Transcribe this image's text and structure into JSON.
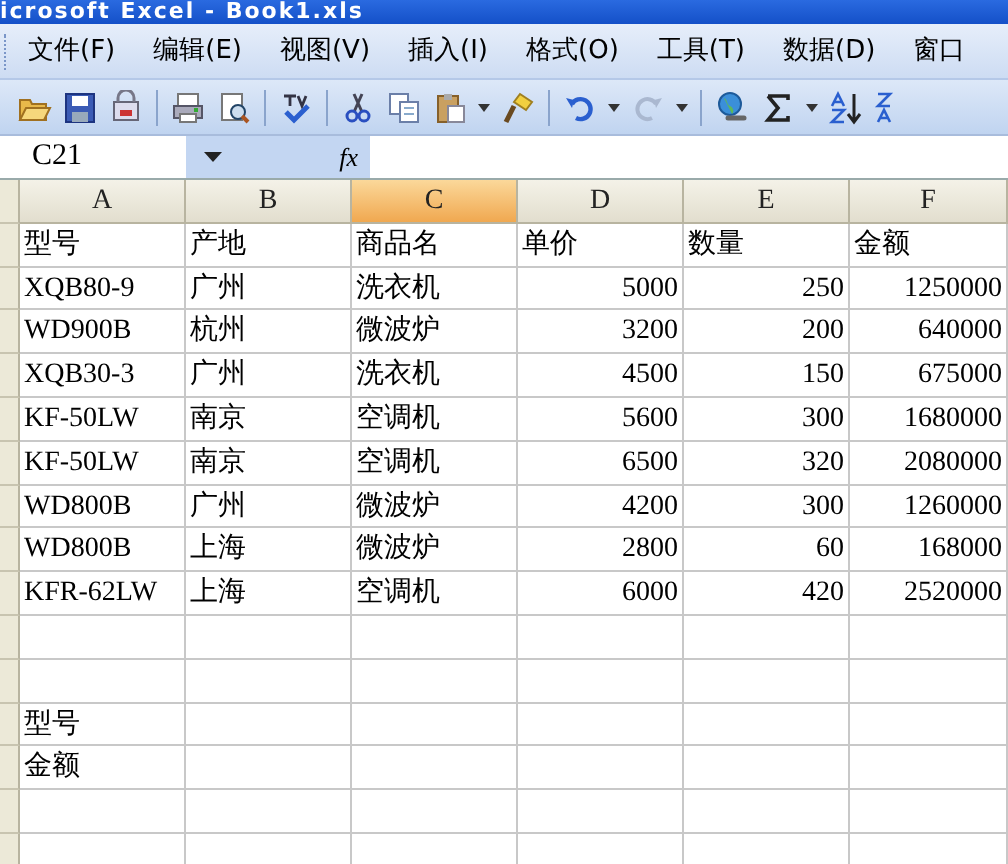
{
  "window": {
    "title": "icrosoft Excel - Book1.xls"
  },
  "menu": [
    "文件(F)",
    "编辑(E)",
    "视图(V)",
    "插入(I)",
    "格式(O)",
    "工具(T)",
    "数据(D)",
    "窗口"
  ],
  "formula_bar": {
    "name_box": "C21",
    "fx_label": "fx"
  },
  "columns": [
    {
      "letter": "A",
      "selected": false,
      "numeric": false
    },
    {
      "letter": "B",
      "selected": false,
      "numeric": false
    },
    {
      "letter": "C",
      "selected": true,
      "numeric": false
    },
    {
      "letter": "D",
      "selected": false,
      "numeric": true
    },
    {
      "letter": "E",
      "selected": false,
      "numeric": true
    },
    {
      "letter": "F",
      "selected": false,
      "numeric": true
    }
  ],
  "rows": [
    {
      "kind": "labels",
      "cells": [
        "型号",
        "产地",
        "商品名",
        "单价",
        "数量",
        "金额"
      ]
    },
    {
      "kind": "record",
      "cells": [
        "XQB80-9",
        "广州",
        "洗衣机",
        "5000",
        "250",
        "1250000"
      ]
    },
    {
      "kind": "record",
      "cells": [
        "WD900B",
        "杭州",
        "微波炉",
        "3200",
        "200",
        "640000"
      ]
    },
    {
      "kind": "record",
      "cells": [
        "XQB30-3",
        "广州",
        "洗衣机",
        "4500",
        "150",
        "675000"
      ]
    },
    {
      "kind": "record",
      "cells": [
        "KF-50LW",
        "南京",
        "空调机",
        "5600",
        "300",
        "1680000"
      ]
    },
    {
      "kind": "record",
      "cells": [
        "KF-50LW",
        "南京",
        "空调机",
        "6500",
        "320",
        "2080000"
      ]
    },
    {
      "kind": "record",
      "cells": [
        "WD800B",
        "广州",
        "微波炉",
        "4200",
        "300",
        "1260000"
      ]
    },
    {
      "kind": "record",
      "cells": [
        "WD800B",
        "上海",
        "微波炉",
        "2800",
        "60",
        "168000"
      ]
    },
    {
      "kind": "record",
      "cells": [
        "KFR-62LW",
        "上海",
        "空调机",
        "6000",
        "420",
        "2520000"
      ]
    },
    {
      "kind": "blank"
    },
    {
      "kind": "blank"
    },
    {
      "kind": "labels",
      "cells": [
        "型号"
      ]
    },
    {
      "kind": "labels",
      "cells": [
        "金额"
      ]
    },
    {
      "kind": "blank"
    },
    {
      "kind": "blank"
    }
  ]
}
